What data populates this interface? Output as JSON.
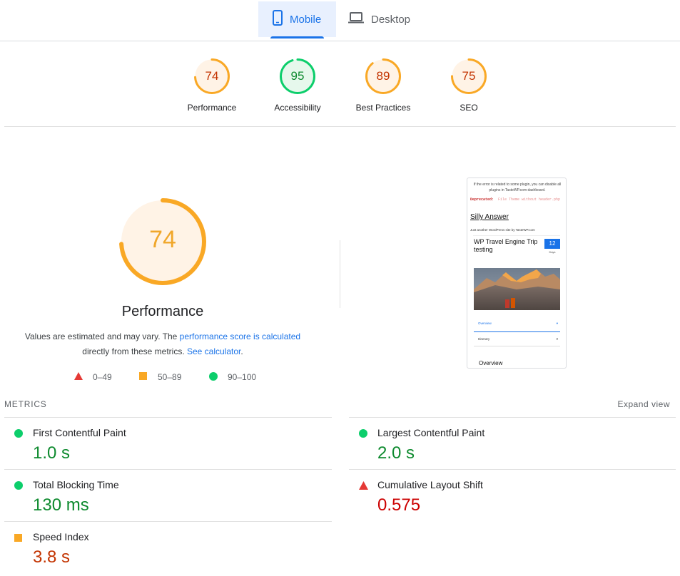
{
  "tabs": [
    {
      "label": "Mobile",
      "icon": "smartphone-icon",
      "active": true
    },
    {
      "label": "Desktop",
      "icon": "laptop-icon",
      "active": false
    }
  ],
  "categories": [
    {
      "label": "Performance",
      "score": "74",
      "fraction": 0.74,
      "status": "average"
    },
    {
      "label": "Accessibility",
      "score": "95",
      "fraction": 0.95,
      "status": "pass"
    },
    {
      "label": "Best Practices",
      "score": "89",
      "fraction": 0.89,
      "status": "average"
    },
    {
      "label": "SEO",
      "score": "75",
      "fraction": 0.75,
      "status": "average"
    }
  ],
  "performance": {
    "score": "74",
    "fraction": 0.74,
    "title": "Performance",
    "desc_prefix": "Values are estimated and may vary. The ",
    "desc_link": "performance score is calculated",
    "desc_middle": " directly from these metrics. ",
    "desc_link2": "See calculator",
    "desc_end": "."
  },
  "legend": [
    {
      "range": "0–49",
      "shape": "triangle",
      "color": "#e53935"
    },
    {
      "range": "50–89",
      "shape": "square",
      "color": "#f9a825"
    },
    {
      "range": "90–100",
      "shape": "circle",
      "color": "#0cce6b"
    }
  ],
  "screenshot": {
    "note": "If the error is related to some plugin, you can disable all plugins in TasteWP.com dashboard.",
    "dep_label": "Deprecated:",
    "dep_text": "File Theme without header.php",
    "site_title": "Silly Answer",
    "tagline": "Just another WordPress site by TasteWP.com",
    "trip_title": "WP Travel Engine Trip testing",
    "badge_num": "12",
    "badge_unit": "Days",
    "acc1": "Overview",
    "acc2": "Itinerary",
    "section": "Overview"
  },
  "metrics": {
    "heading": "METRICS",
    "expand_label": "Expand view",
    "items": [
      {
        "name": "First Contentful Paint",
        "value": "1.0 s",
        "status": "good"
      },
      {
        "name": "Largest Contentful Paint",
        "value": "2.0 s",
        "status": "good"
      },
      {
        "name": "Total Blocking Time",
        "value": "130 ms",
        "status": "good"
      },
      {
        "name": "Cumulative Layout Shift",
        "value": "0.575",
        "status": "bad"
      },
      {
        "name": "Speed Index",
        "value": "3.8 s",
        "status": "average"
      }
    ]
  },
  "colors": {
    "pass": "#0cce6b",
    "pass_text": "#0d8a2e",
    "pass_bg": "#e6f8ec",
    "average": "#f9a825",
    "average_text": "#c33300",
    "average_bg": "#fff3e6",
    "fail": "#e53935",
    "fail_text": "#cc0000",
    "accent": "#1a73e8"
  }
}
